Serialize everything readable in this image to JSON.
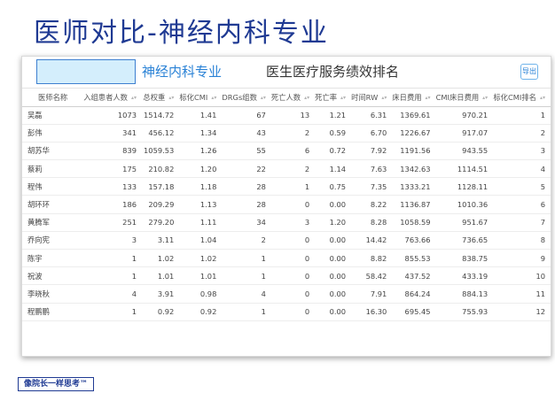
{
  "slide": {
    "title": "医师对比-神经内科专业",
    "footer": "像院长一样思考™"
  },
  "panel": {
    "department": "神经内科专业",
    "report_title": "医生医疗服务绩效排名",
    "export_label": "导出"
  },
  "columns": [
    "医师名称",
    "入组患者人数",
    "总权重",
    "标化CMI",
    "DRGs组数",
    "死亡人数",
    "死亡率",
    "时间RW",
    "床日费用",
    "CMI床日费用",
    "标化CMI排名"
  ],
  "rows": [
    [
      "吴磊",
      "1073",
      "1514.72",
      "1.41",
      "67",
      "13",
      "1.21",
      "6.31",
      "1369.61",
      "970.21",
      "1"
    ],
    [
      "彭伟",
      "341",
      "456.12",
      "1.34",
      "43",
      "2",
      "0.59",
      "6.70",
      "1226.67",
      "917.07",
      "2"
    ],
    [
      "胡苏华",
      "839",
      "1059.53",
      "1.26",
      "55",
      "6",
      "0.72",
      "7.92",
      "1191.56",
      "943.55",
      "3"
    ],
    [
      "蔡莉",
      "175",
      "210.82",
      "1.20",
      "22",
      "2",
      "1.14",
      "7.63",
      "1342.63",
      "1114.51",
      "4"
    ],
    [
      "程伟",
      "133",
      "157.18",
      "1.18",
      "28",
      "1",
      "0.75",
      "7.35",
      "1333.21",
      "1128.11",
      "5"
    ],
    [
      "胡环环",
      "186",
      "209.29",
      "1.13",
      "28",
      "0",
      "0.00",
      "8.22",
      "1136.87",
      "1010.36",
      "6"
    ],
    [
      "黄腾军",
      "251",
      "279.20",
      "1.11",
      "34",
      "3",
      "1.20",
      "8.28",
      "1058.59",
      "951.67",
      "7"
    ],
    [
      "乔向宪",
      "3",
      "3.11",
      "1.04",
      "2",
      "0",
      "0.00",
      "14.42",
      "763.66",
      "736.65",
      "8"
    ],
    [
      "陈宇",
      "1",
      "1.02",
      "1.02",
      "1",
      "0",
      "0.00",
      "8.82",
      "855.53",
      "838.75",
      "9"
    ],
    [
      "祝波",
      "1",
      "1.01",
      "1.01",
      "1",
      "0",
      "0.00",
      "58.42",
      "437.52",
      "433.19",
      "10"
    ],
    [
      "李晓秋",
      "4",
      "3.91",
      "0.98",
      "4",
      "0",
      "0.00",
      "7.91",
      "864.24",
      "884.13",
      "11"
    ],
    [
      "程鹏鹏",
      "1",
      "0.92",
      "0.92",
      "1",
      "0",
      "0.00",
      "16.30",
      "695.45",
      "755.93",
      "12"
    ]
  ]
}
